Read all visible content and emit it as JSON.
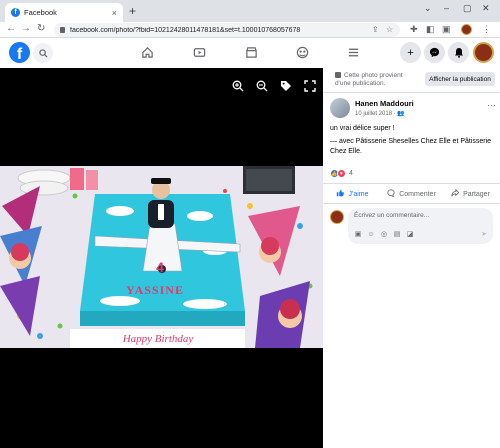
{
  "browser": {
    "tab_title": "Facebook",
    "tab_close": "×",
    "new_tab": "+",
    "window_controls": [
      "⌄",
      "–",
      "▢",
      "✕"
    ],
    "nav": {
      "back": "←",
      "forward": "→",
      "reload": "↻"
    },
    "url": "facebook.com/photo/?fbid=10212428011478181&set=t.100010768057678",
    "toolbar_icons": [
      "share-icon",
      "star-icon",
      "extensions-icon",
      "sidepanel-icon",
      "profile-icon",
      "menu-icon"
    ]
  },
  "facebook": {
    "logo": "f",
    "nav_icons": [
      "home-icon",
      "watch-icon",
      "marketplace-icon",
      "groups-icon",
      "menu-icon"
    ],
    "right_buttons": [
      "create-icon",
      "messenger-icon",
      "notifications-icon"
    ]
  },
  "viewer": {
    "tools": [
      "zoom-in-icon",
      "zoom-out-icon",
      "tag-icon",
      "fullscreen-icon"
    ],
    "cake": {
      "number": "4",
      "name": "YASSINE",
      "greeting": "Happy Birthday"
    }
  },
  "sidebar": {
    "notice": "Cette photo provient d'une publication.",
    "tag_button": "Afficher la publication",
    "post": {
      "author": "Hanen Maddouri",
      "date": "10 juillet 2018 · ",
      "text_line1": "un vrai délice super !",
      "text_line2": "— avec Pâtisserie Sheselles Chez Elle et Pâtisserie Chez Elle."
    },
    "reactions": {
      "count": "4"
    },
    "actions": {
      "like": "J'aime",
      "comment": "Commenter",
      "share": "Partager"
    },
    "comment_box": {
      "placeholder": "Écrivez un commentaire..."
    }
  },
  "colors": {
    "brand": "#1877f2",
    "viewer_bg": "#000000",
    "cake_frosting": "#2fc6de"
  }
}
